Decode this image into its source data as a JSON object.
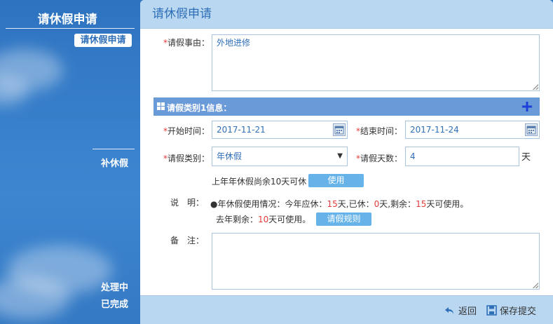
{
  "sidebar": {
    "title": "请休假申请",
    "active_item": "请休假申请",
    "items": [
      {
        "label": "补休假"
      },
      {
        "label": "处理中"
      },
      {
        "label": "已完成"
      }
    ]
  },
  "main": {
    "title": "请休假申请",
    "form": {
      "reason_label": "请假事由：",
      "reason_value": "外地进修",
      "section_title": "请假类别1信息：",
      "start_label": "开始时间：",
      "start_value": "2017-11-21",
      "end_label": "结束时间：",
      "end_value": "2017-11-24",
      "type_label": "请假类别：",
      "type_value": "年休假",
      "days_label": "请假天数：",
      "days_value": "4",
      "days_unit": "天",
      "last_year_note": "上年年休假尚余10天可休",
      "use_button": "使用",
      "desc_label": "说　明：",
      "desc_line1_prefix": "●年休假使用情况：今年应休：",
      "desc_due": "15",
      "desc_mid1": "天,已休：",
      "desc_used": "0",
      "desc_mid2": "天,剩余：",
      "desc_left": "15",
      "desc_suffix1": "天可使用。",
      "desc_line2_prefix": "去年剩余：",
      "desc_last_left": "10",
      "desc_suffix2": "天可使用。",
      "rules_button": "请假规则",
      "remark_label": "备　注："
    },
    "footer": {
      "back_label": "返回",
      "save_label": "保存提交"
    }
  },
  "colors": {
    "sidebar_bg": "#2f74c0",
    "header_bg": "#b9d7f1",
    "section_bar": "#6b9ad8",
    "accent_blue": "#2e6fb8",
    "button_blue": "#66b3ea",
    "required_red": "#e63b3b"
  },
  "icons": {
    "section": "grid-icon",
    "add": "plus-icon",
    "calendar": "calendar-icon",
    "dropdown": "caret-down-icon",
    "back": "back-arrow-icon",
    "save": "save-disk-icon"
  }
}
